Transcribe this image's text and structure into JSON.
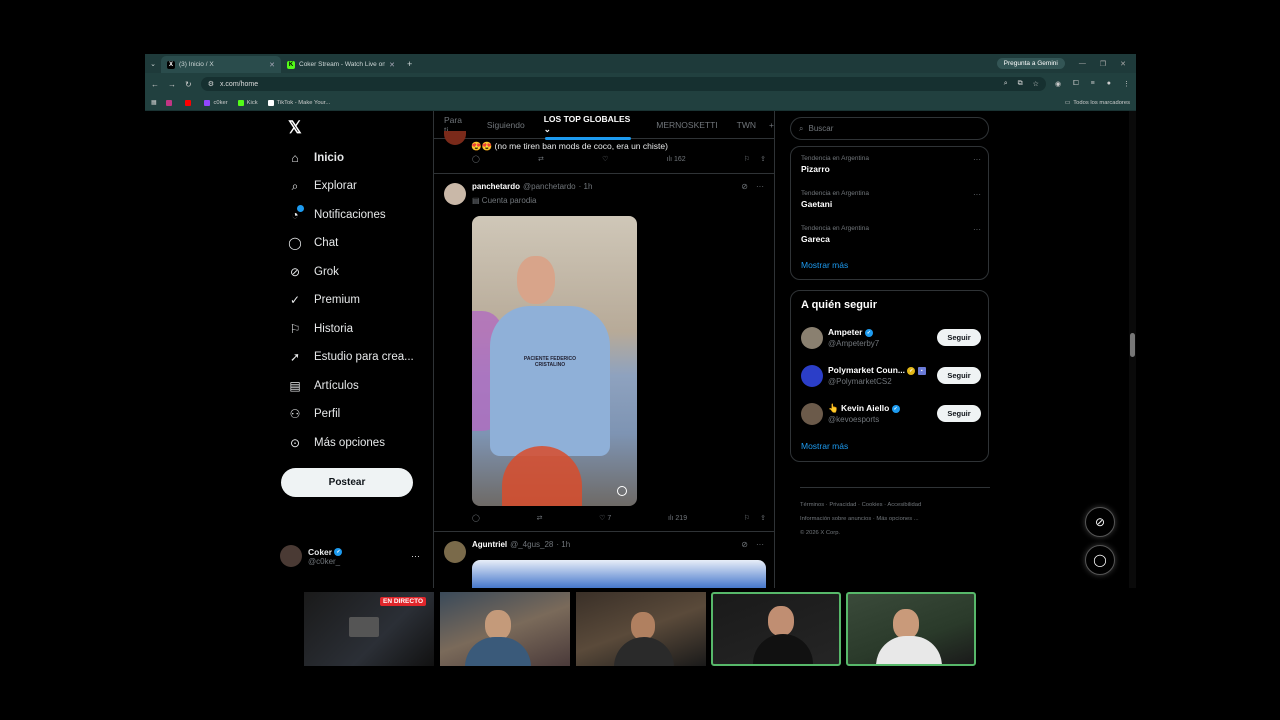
{
  "browser": {
    "tabs": [
      {
        "title": "(3) Inicio / X",
        "icon": "x-logo-icon",
        "active": true
      },
      {
        "title": "Coker Stream - Watch Live on K",
        "icon": "kick-icon",
        "active": false
      }
    ],
    "gemini_label": "Pregunta a Gemini",
    "url": "x.com/home",
    "bookmarks": [
      {
        "label": "",
        "color": "#c13584"
      },
      {
        "label": "",
        "color": "#ff0000"
      },
      {
        "label": "c0ker",
        "color": "#9146ff"
      },
      {
        "label": "Kick",
        "color": "#53fc18"
      },
      {
        "label": "TikTok - Make Your...",
        "color": "#ffffff"
      }
    ],
    "all_bookmarks": "Todos los marcadores"
  },
  "nav": {
    "items": [
      {
        "label": "Inicio",
        "icon": "home-icon"
      },
      {
        "label": "Explorar",
        "icon": "search-icon"
      },
      {
        "label": "Notificaciones",
        "icon": "bell-icon"
      },
      {
        "label": "Chat",
        "icon": "chat-icon"
      },
      {
        "label": "Grok",
        "icon": "grok-icon"
      },
      {
        "label": "Premium",
        "icon": "premium-icon"
      },
      {
        "label": "Historia",
        "icon": "bookmark-icon"
      },
      {
        "label": "Estudio para crea...",
        "icon": "rocket-icon"
      },
      {
        "label": "Artículos",
        "icon": "article-icon"
      },
      {
        "label": "Perfil",
        "icon": "person-icon"
      },
      {
        "label": "Más opciones",
        "icon": "more-icon"
      }
    ],
    "post_label": "Postear",
    "me": {
      "name": "Coker",
      "handle": "@c0ker_"
    }
  },
  "feed": {
    "tabs": [
      "Para ti",
      "Siguiendo",
      "LOS TOP GLOBALES",
      "MERNOSKETTI",
      "TWN"
    ],
    "prev_tweet": {
      "text": "😍😍 (no me tiren ban mods de coco, era un chiste)",
      "views": "162"
    },
    "tweet1": {
      "name": "panchetardo",
      "handle": "@panchetardo",
      "time": "· 1h",
      "sub": "Cuenta parodia",
      "shirt": "PACIENTE FEDERICO CRISTALINO",
      "likes": "7",
      "views": "219"
    },
    "tweet2": {
      "name": "Aguntriel",
      "handle": "@_4gus_28",
      "time": "· 1h"
    }
  },
  "right": {
    "search_placeholder": "Buscar",
    "trends": [
      {
        "context": "Tendencia en Argentina",
        "title": "Pizarro"
      },
      {
        "context": "Tendencia en Argentina",
        "title": "Gaetani"
      },
      {
        "context": "Tendencia en Argentina",
        "title": "Gareca"
      }
    ],
    "show_more": "Mostrar más",
    "follow_title": "A quién seguir",
    "follow": [
      {
        "name": "Ampeter",
        "handle": "@Ampeterby7",
        "color": "#8a8070"
      },
      {
        "name": "Polymarket Coun...",
        "handle": "@PolymarketCS2",
        "color": "#2b3ec8"
      },
      {
        "name": "👆 Kevin Aiello",
        "handle": "@kevoesports",
        "color": "#6b5a4a"
      }
    ],
    "follow_button": "Seguir",
    "footer": [
      "Términos",
      "Privacidad",
      "Cookies",
      "Accesibilidad",
      "Información sobre anuncios",
      "Más opciones ...",
      "© 2026 X Corp."
    ]
  },
  "stream": {
    "live_label": "EN DIRECTO"
  }
}
